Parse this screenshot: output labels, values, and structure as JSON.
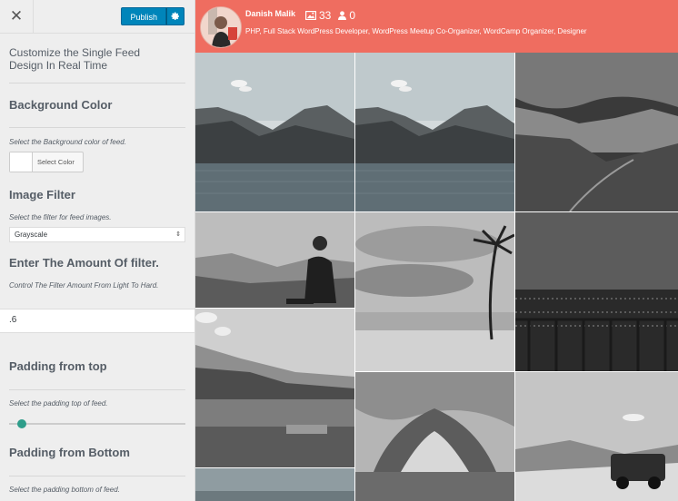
{
  "customizer": {
    "close_glyph": "✕",
    "publish_label": "Publish",
    "title": "Customize the Single Feed Design In Real Time",
    "background": {
      "heading": "Background Color",
      "description": "Select the Background color of feed.",
      "button_label": "Select Color"
    },
    "filter": {
      "heading": "Image Filter",
      "description": "Select the filter for feed images.",
      "selected": "Grayscale"
    },
    "amount": {
      "heading": "Enter The Amount Of filter.",
      "description": "Control The Filter Amount From Light To Hard.",
      "value": ".6"
    },
    "padding_top": {
      "heading": "Padding from top",
      "description": "Select the padding top of feed.",
      "slider_fraction": 0.07
    },
    "padding_bottom": {
      "heading": "Padding from Bottom",
      "description": "Select the padding bottom of feed."
    }
  },
  "profile": {
    "name": "Danish Malik",
    "posts_count": "33",
    "followers_count": "0",
    "bio": "PHP, Full Stack WordPress Developer, WordPress Meetup Co-Organizer, WordCamp Organizer, Designer",
    "icons": [
      "image-icon",
      "user-icon"
    ]
  },
  "feed": {
    "images": [
      "mountain-lake-photo",
      "mountain-lake-photo",
      "mountain-valley-photo",
      "hiker-sitting-photo",
      "palm-beach-photo",
      "city-night-photo",
      "lakeside-park-photo",
      "monument-photo",
      "jeep-desert-photo",
      "partial-photo",
      "partial-photo",
      "partial-photo"
    ]
  },
  "colors": {
    "accent": "#0085ba",
    "profile_bar": "#ef6d60",
    "slider": "#2e9d8a"
  }
}
